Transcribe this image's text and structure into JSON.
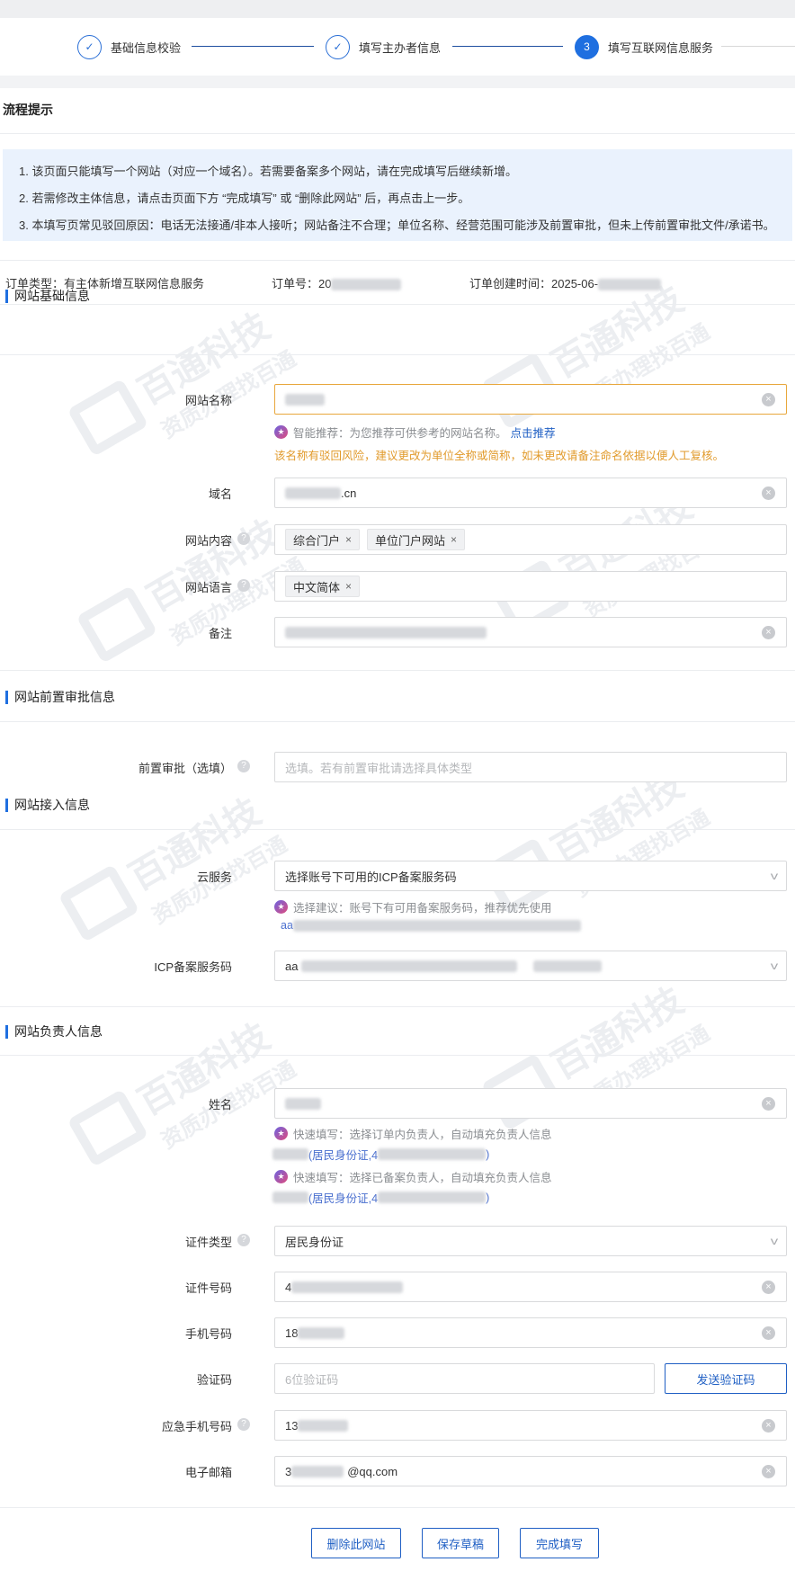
{
  "steps": [
    {
      "label": "基础信息校验",
      "marker": "✓"
    },
    {
      "label": "填写主办者信息",
      "marker": "✓"
    },
    {
      "label": "填写互联网信息服务",
      "marker": "3"
    }
  ],
  "flow_title": "流程提示",
  "notices": [
    "1. 该页面只能填写一个网站（对应一个域名）。若需要备案多个网站，请在完成填写后继续新增。",
    "2. 若需修改主体信息，请点击页面下方 “完成填写” 或 “删除此网站” 后，再点击上一步。",
    "3. 本填写页常见驳回原因：电话无法接通/非本人接听；网站备注不合理；单位名称、经营范围可能涉及前置审批，但未上传前置审批文件/承诺书。"
  ],
  "order": {
    "type": "订单类型：有主体新增互联网信息服务",
    "number": "订单号：20",
    "created": "订单创建时间：2025-06-"
  },
  "watermark": {
    "brand": "百通科技",
    "slogan": "资质办理找百通"
  },
  "sections": {
    "basic": "网站基础信息",
    "pre_approval": "网站前置审批信息",
    "access": "网站接入信息",
    "owner": "网站负责人信息"
  },
  "basic": {
    "site_name_label": "网站名称",
    "smart_hint": "智能推荐：为您推荐可供参考的网站名称。",
    "smart_link": "点击推荐",
    "risk_warning": "该名称有驳回风险，建议更改为单位全称或简称，如未更改请备注命名依据以便人工复核。",
    "domain_label": "域名",
    "domain_suffix": ".cn",
    "content_label": "网站内容",
    "content_tags": [
      "综合门户",
      "单位门户网站"
    ],
    "language_label": "网站语言",
    "language_tags": [
      "中文简体"
    ],
    "remark_label": "备注"
  },
  "pre_approval": {
    "label": "前置审批（选填）",
    "placeholder": "选填。若有前置审批请选择具体类型"
  },
  "access": {
    "cloud_label": "云服务",
    "cloud_value": "选择账号下可用的ICP备案服务码",
    "cloud_hint": "选择建议：账号下有可用备案服务码，推荐优先使用",
    "cloud_code_prefix": "aa",
    "icp_label": "ICP备案服务码",
    "icp_prefix": "aa"
  },
  "owner": {
    "name_label": "姓名",
    "quick1": "快速填写：选择订单内负责人，自动填充负责人信息",
    "quick1_id": "(居民身份证,4",
    "quick1_end": ")",
    "quick2": "快速填写：选择已备案负责人，自动填充负责人信息",
    "quick2_id": "(居民身份证,4",
    "quick2_end": ")",
    "id_type_label": "证件类型",
    "id_type_value": "居民身份证",
    "id_no_label": "证件号码",
    "id_no_prefix": "4",
    "phone_label": "手机号码",
    "phone_prefix": "18",
    "code_label": "验证码",
    "code_placeholder": "6位验证码",
    "send_code": "发送验证码",
    "emergency_label": "应急手机号码",
    "emergency_prefix": "13",
    "email_label": "电子邮箱",
    "email_prefix": "3",
    "email_suffix": "@qq.com"
  },
  "buttons": {
    "delete": "删除此网站",
    "save": "保存草稿",
    "finish": "完成填写"
  },
  "icons": {
    "help": "?",
    "clear": "×",
    "chevron": "v",
    "star": "★",
    "tag_remove": "×"
  }
}
